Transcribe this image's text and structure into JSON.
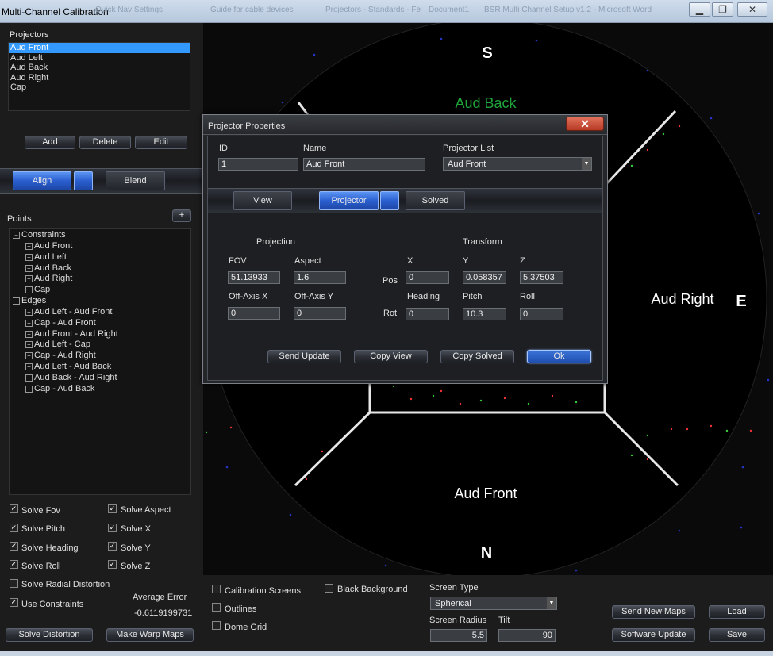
{
  "window": {
    "title": "Multi-Channel Calibration",
    "background_titles": [
      "Quick Nav Settings",
      "Guide for cable devices",
      "Projectors - Standards - Fe",
      "Document1",
      "BSR Multi Channel Setup v1.2 - Microsoft Word"
    ],
    "minimize_label": "▁",
    "maximize_label": "❐",
    "close_label": "✕"
  },
  "left": {
    "projectors_label": "Projectors",
    "projectors": [
      "Aud Front",
      "Aud Left",
      "Aud Back",
      "Aud Right",
      "Cap"
    ],
    "selected_projector": 0,
    "add_label": "Add",
    "delete_label": "Delete",
    "edit_label": "Edit",
    "align_tab": "Align",
    "blend_tab": "Blend",
    "points_label": "Points",
    "plus_label": "+",
    "tree": {
      "constraints_label": "Constraints",
      "constraints": [
        "Aud Front",
        "Aud Left",
        "Aud Back",
        "Aud Right",
        "Cap"
      ],
      "edges_label": "Edges",
      "edges": [
        "Aud Left - Aud Front",
        "Cap - Aud Front",
        "Aud Front - Aud Right",
        "Aud Left - Cap",
        "Cap - Aud Right",
        "Aud Left - Aud Back",
        "Aud Back - Aud Right",
        "Cap - Aud Back"
      ]
    },
    "checks": [
      {
        "label": "Solve Fov",
        "checked": true
      },
      {
        "label": "Solve Aspect",
        "checked": true
      },
      {
        "label": "Solve Pitch",
        "checked": true
      },
      {
        "label": "Solve X",
        "checked": true
      },
      {
        "label": "Solve Heading",
        "checked": true
      },
      {
        "label": "Solve Y",
        "checked": true
      },
      {
        "label": "Solve Roll",
        "checked": true
      },
      {
        "label": "Solve Z",
        "checked": true
      },
      {
        "label": "Solve Radial Distortion",
        "checked": false
      },
      {
        "label": "Use Constraints",
        "checked": true
      }
    ],
    "avg_error_label": "Average Error",
    "avg_error_value": "-0.6119199731",
    "solve_distortion_label": "Solve Distortion",
    "make_warp_maps_label": "Make Warp Maps"
  },
  "dome": {
    "south": "S",
    "north": "N",
    "east": "E",
    "label_back": "Aud Back",
    "label_right": "Aud Right",
    "label_front": "Aud Front",
    "back_color": "#1fa33a"
  },
  "dialog": {
    "title": "Projector Properties",
    "close_label": "✕",
    "id_label": "ID",
    "id_value": "1",
    "name_label": "Name",
    "name_value": "Aud Front",
    "projector_list_label": "Projector List",
    "projector_list_value": "Aud Front",
    "tabs": [
      "View",
      "Projector",
      "Solved"
    ],
    "projection_label": "Projection",
    "transform_label": "Transform",
    "fov_label": "FOV",
    "fov_value": "51.13933",
    "aspect_label": "Aspect",
    "aspect_value": "1.6",
    "offx_label": "Off-Axis X",
    "offx_value": "0",
    "offy_label": "Off-Axis Y",
    "offy_value": "0",
    "x_label": "X",
    "y_label": "Y",
    "z_label": "Z",
    "pos_label": "Pos",
    "pos_x": "0",
    "pos_y": "0.058357",
    "pos_z": "5.37503",
    "heading_label": "Heading",
    "pitch_label": "Pitch",
    "roll_label": "Roll",
    "rot_label": "Rot",
    "rot_heading": "0",
    "rot_pitch": "10.3",
    "rot_roll": "0",
    "send_update_label": "Send Update",
    "copy_view_label": "Copy View",
    "copy_solved_label": "Copy Solved",
    "ok_label": "Ok"
  },
  "bottom": {
    "calibration_screens_label": "Calibration Screens",
    "outlines_label": "Outlines",
    "dome_grid_label": "Dome Grid",
    "black_background_label": "Black Background",
    "screen_type_label": "Screen Type",
    "screen_type_value": "Spherical",
    "screen_radius_label": "Screen Radius",
    "screen_radius_value": "5.5",
    "tilt_label": "Tilt",
    "tilt_value": "90",
    "send_new_maps_label": "Send New Maps",
    "load_label": "Load",
    "software_update_label": "Software Update",
    "save_label": "Save"
  }
}
